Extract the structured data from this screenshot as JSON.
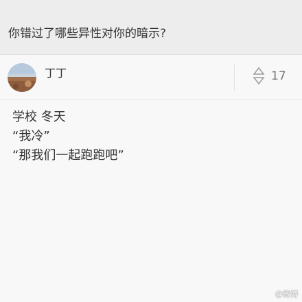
{
  "question": {
    "title": "你错过了哪些异性对你的暗示?"
  },
  "answer": {
    "author": "丁丁",
    "vote_count": "17",
    "lines": [
      "学校 冬天",
      "“我冷”",
      "“那我们一起跑跑吧”"
    ]
  },
  "watermark": "@微博",
  "icons": {
    "vote": "vote-up-down-icon",
    "avatar": "avatar-landscape"
  }
}
